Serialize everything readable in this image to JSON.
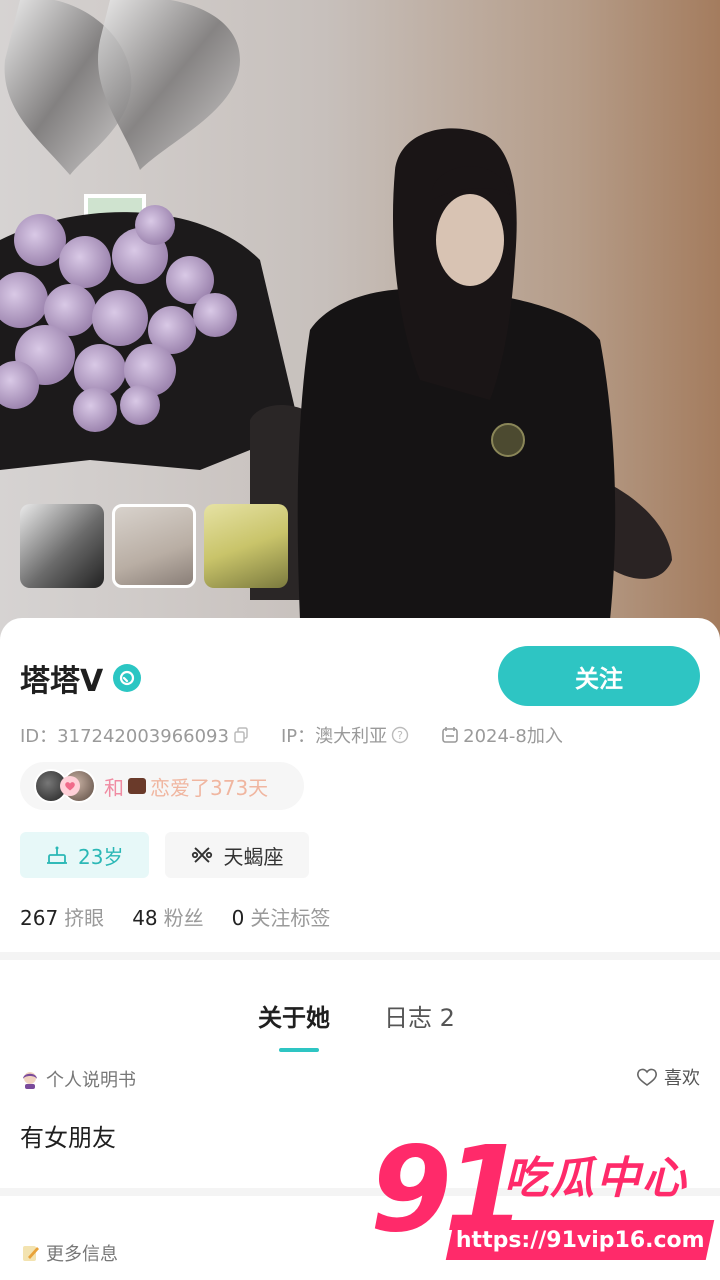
{
  "profile": {
    "name": "塔塔V",
    "follow_label": "关注",
    "id_text": "ID：317242003966093",
    "ip_text": "IP：澳大利亚",
    "joined_text": "2024-8加入",
    "couple": {
      "prefix": "和",
      "text": "恋爱了373天"
    },
    "tags": {
      "age": "23岁",
      "zodiac": "天蝎座"
    },
    "stats": [
      {
        "num": "267",
        "label": "挤眼"
      },
      {
        "num": "48",
        "label": "粉丝"
      },
      {
        "num": "0",
        "label": "关注标签"
      }
    ]
  },
  "tabs": {
    "about": "关于她",
    "diary": "日志 2"
  },
  "sections": {
    "about_title": "个人说明书",
    "like_label": "喜欢",
    "about_text": "有女朋友",
    "more_title": "更多信息"
  },
  "watermark": {
    "num": "91",
    "title": "吃瓜中心",
    "url": "https://91vip16.com"
  },
  "colors": {
    "accent": "#2ec5c3",
    "couple_pink": "#f08ba2",
    "watermark": "#ff2a6a"
  },
  "icons": {
    "verified": "verified-badge-icon",
    "copy": "copy-icon",
    "help": "question-circle-icon",
    "calendar": "calendar-icon",
    "cake": "cake-icon",
    "zodiac": "scorpio-icon",
    "heart": "heart-outline-icon"
  }
}
